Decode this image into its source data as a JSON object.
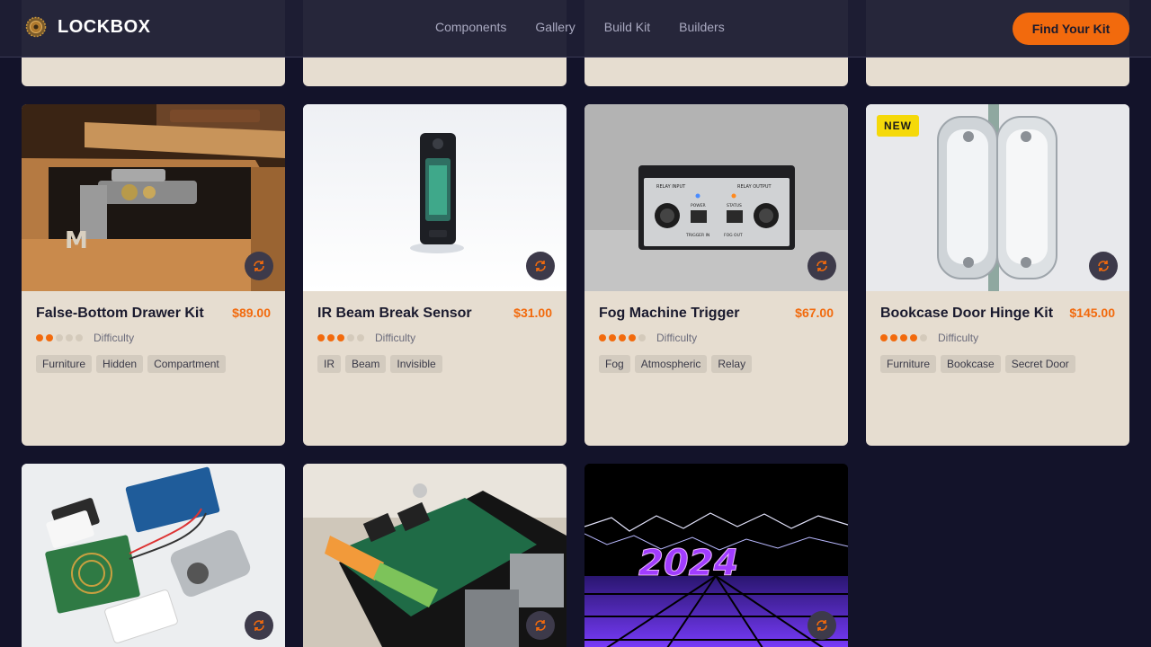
{
  "header": {
    "brand": "LOCKBOX",
    "nav": [
      "Components",
      "Gallery",
      "Build Kit",
      "Builders"
    ],
    "cta": "Find Your Kit"
  },
  "difficulty_label": "Difficulty",
  "colors": {
    "accent": "#f26a0d",
    "badge": "#f5d90a",
    "card": "#e6ddd0",
    "background": "#13132a"
  },
  "cards": [
    {
      "title": "False-Bottom Drawer Kit",
      "price": "$89.00",
      "difficulty": 2,
      "tags": [
        "Furniture",
        "Hidden",
        "Compartment"
      ],
      "badge": ""
    },
    {
      "title": "IR Beam Break Sensor",
      "price": "$31.00",
      "difficulty": 3,
      "tags": [
        "IR",
        "Beam",
        "Invisible"
      ],
      "badge": ""
    },
    {
      "title": "Fog Machine Trigger",
      "price": "$67.00",
      "difficulty": 4,
      "tags": [
        "Fog",
        "Atmospheric",
        "Relay"
      ],
      "badge": "",
      "image_text": {
        "relay_input": "RELAY INPUT",
        "relay_output": "RELAY OUTPUT",
        "power": "POWER",
        "status": "STATUS",
        "trigger_in": "TRIGGER IN",
        "fog_out": "FOG OUT"
      }
    },
    {
      "title": "Bookcase Door Hinge Kit",
      "price": "$145.00",
      "difficulty": 4,
      "tags": [
        "Furniture",
        "Bookcase",
        "Secret Door"
      ],
      "badge": "NEW"
    }
  ],
  "bottom_row": [
    {
      "image": "rfid-arduino-solenoid"
    },
    {
      "image": "relay-board-raspberry-pi"
    },
    {
      "image_text": "2024"
    }
  ]
}
